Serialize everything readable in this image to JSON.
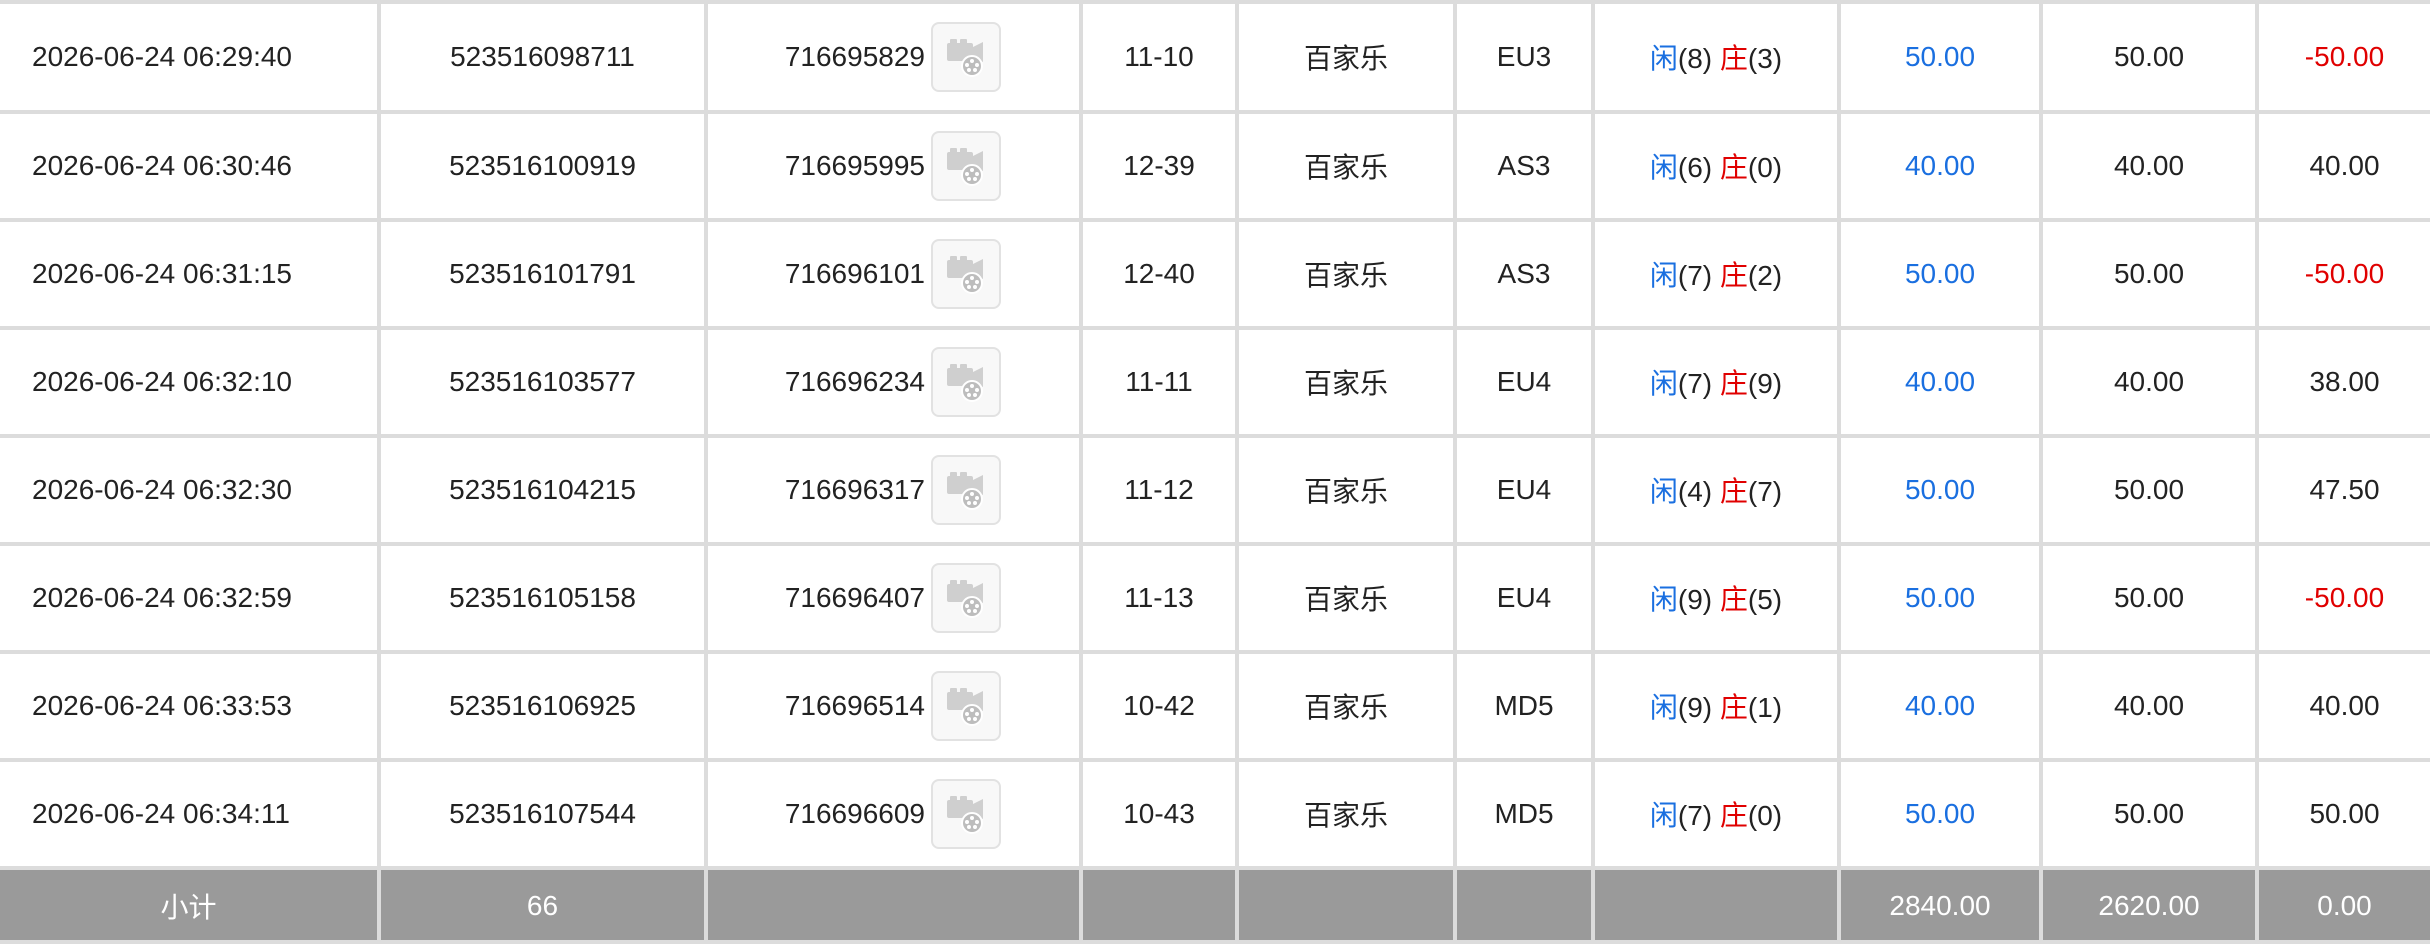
{
  "rows": [
    {
      "time": "2026-06-24 06:29:40",
      "bet_id": "523516098711",
      "round_id": "716695829",
      "shoe_round": "11-10",
      "game": "百家乐",
      "table": "EU3",
      "player_label": "闲",
      "player_score": "(8)",
      "banker_label": "庄",
      "banker_score": "(3)",
      "bet_amount": "50.00",
      "valid_bet": "50.00",
      "win_loss": "-50.00",
      "win_loss_negative": true
    },
    {
      "time": "2026-06-24 06:30:46",
      "bet_id": "523516100919",
      "round_id": "716695995",
      "shoe_round": "12-39",
      "game": "百家乐",
      "table": "AS3",
      "player_label": "闲",
      "player_score": "(6)",
      "banker_label": "庄",
      "banker_score": "(0)",
      "bet_amount": "40.00",
      "valid_bet": "40.00",
      "win_loss": "40.00",
      "win_loss_negative": false
    },
    {
      "time": "2026-06-24 06:31:15",
      "bet_id": "523516101791",
      "round_id": "716696101",
      "shoe_round": "12-40",
      "game": "百家乐",
      "table": "AS3",
      "player_label": "闲",
      "player_score": "(7)",
      "banker_label": "庄",
      "banker_score": "(2)",
      "bet_amount": "50.00",
      "valid_bet": "50.00",
      "win_loss": "-50.00",
      "win_loss_negative": true
    },
    {
      "time": "2026-06-24 06:32:10",
      "bet_id": "523516103577",
      "round_id": "716696234",
      "shoe_round": "11-11",
      "game": "百家乐",
      "table": "EU4",
      "player_label": "闲",
      "player_score": "(7)",
      "banker_label": "庄",
      "banker_score": "(9)",
      "bet_amount": "40.00",
      "valid_bet": "40.00",
      "win_loss": "38.00",
      "win_loss_negative": false
    },
    {
      "time": "2026-06-24 06:32:30",
      "bet_id": "523516104215",
      "round_id": "716696317",
      "shoe_round": "11-12",
      "game": "百家乐",
      "table": "EU4",
      "player_label": "闲",
      "player_score": "(4)",
      "banker_label": "庄",
      "banker_score": "(7)",
      "bet_amount": "50.00",
      "valid_bet": "50.00",
      "win_loss": "47.50",
      "win_loss_negative": false
    },
    {
      "time": "2026-06-24 06:32:59",
      "bet_id": "523516105158",
      "round_id": "716696407",
      "shoe_round": "11-13",
      "game": "百家乐",
      "table": "EU4",
      "player_label": "闲",
      "player_score": "(9)",
      "banker_label": "庄",
      "banker_score": "(5)",
      "bet_amount": "50.00",
      "valid_bet": "50.00",
      "win_loss": "-50.00",
      "win_loss_negative": true
    },
    {
      "time": "2026-06-24 06:33:53",
      "bet_id": "523516106925",
      "round_id": "716696514",
      "shoe_round": "10-42",
      "game": "百家乐",
      "table": "MD5",
      "player_label": "闲",
      "player_score": "(9)",
      "banker_label": "庄",
      "banker_score": "(1)",
      "bet_amount": "40.00",
      "valid_bet": "40.00",
      "win_loss": "40.00",
      "win_loss_negative": false
    },
    {
      "time": "2026-06-24 06:34:11",
      "bet_id": "523516107544",
      "round_id": "716696609",
      "shoe_round": "10-43",
      "game": "百家乐",
      "table": "MD5",
      "player_label": "闲",
      "player_score": "(7)",
      "banker_label": "庄",
      "banker_score": "(0)",
      "bet_amount": "50.00",
      "valid_bet": "50.00",
      "win_loss": "50.00",
      "win_loss_negative": false
    }
  ],
  "subtotal": {
    "label": "小计",
    "count": "66",
    "bet_amount": "2840.00",
    "valid_bet": "2620.00",
    "win_loss": "0.00"
  },
  "icons": {
    "replay": "video-replay-icon"
  },
  "colors": {
    "player": "#1a6fe0",
    "banker": "#e00000",
    "bet_amount": "#1a6fe0",
    "negative": "#e00000",
    "subtotal_bg": "#9a9a9a"
  }
}
